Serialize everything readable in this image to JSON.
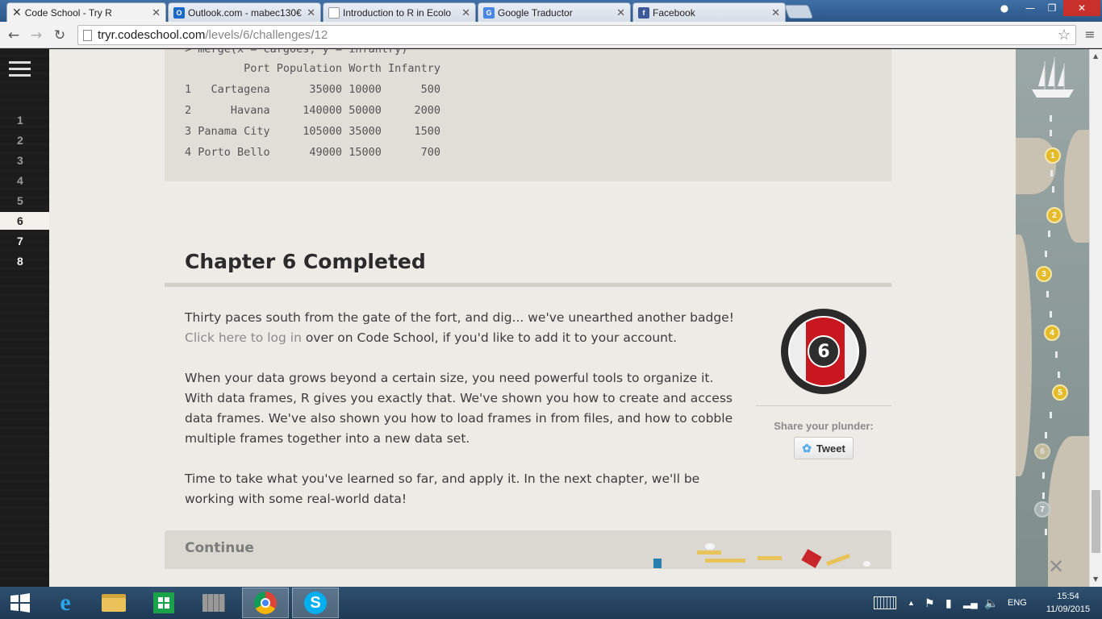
{
  "browser": {
    "tabs": [
      {
        "title": "Code School - Try R",
        "icon": "code-school-icon",
        "active": true
      },
      {
        "title": "Outlook.com - mabec130€",
        "icon": "outlook-icon",
        "active": false
      },
      {
        "title": "Introduction to R in Ecolo",
        "icon": "page-icon",
        "active": false
      },
      {
        "title": "Google Traductor",
        "icon": "google-translate-icon",
        "active": false
      },
      {
        "title": "Facebook",
        "icon": "facebook-icon",
        "active": false
      }
    ],
    "url_host": "tryr.codeschool.com",
    "url_path": "/levels/6/challenges/12"
  },
  "chapters": [
    "1",
    "2",
    "3",
    "4",
    "5",
    "6",
    "7",
    "8"
  ],
  "current_chapter": "6",
  "code": {
    "partial_line": "> merge(x = cargoes, y = infantry)",
    "header": "         Port Population Worth Infantry",
    "rows": [
      "1   Cartagena      35000 10000      500",
      "2      Havana     140000 50000     2000",
      "3 Panama City     105000 35000     1500",
      "4 Porto Bello      49000 15000      700"
    ]
  },
  "main": {
    "title": "Chapter 6 Completed",
    "p1_before": "Thirty paces south from the gate of the fort, and dig... we've unearthed another badge! ",
    "p1_link": "Click here to log in",
    "p1_after": " over on Code School, if you'd like to add it to your account.",
    "p2": "When your data grows beyond a certain size, you need powerful tools to organize it. With data frames, R gives you exactly that. We've shown you how to create and access data frames. We've also shown you how to load frames in from files, and how to cobble multiple frames together into a new data set.",
    "p3": "Time to take what you've learned so far, and apply it. In the next chapter, we'll be working with some real-world data!",
    "badge_number": "6",
    "share_label": "Share your plunder:",
    "tweet_label": "Tweet",
    "continue_label": "Continue"
  },
  "map": {
    "markers": [
      "1",
      "2",
      "3",
      "4",
      "5",
      "6",
      "7"
    ],
    "end_mark": "✕"
  },
  "taskbar": {
    "language": "ENG",
    "time": "15:54",
    "date": "11/09/2015"
  },
  "colors": {
    "badge_red": "#c8171f",
    "marker_gold": "#e6bb2b",
    "page_bg": "#edebe6"
  }
}
